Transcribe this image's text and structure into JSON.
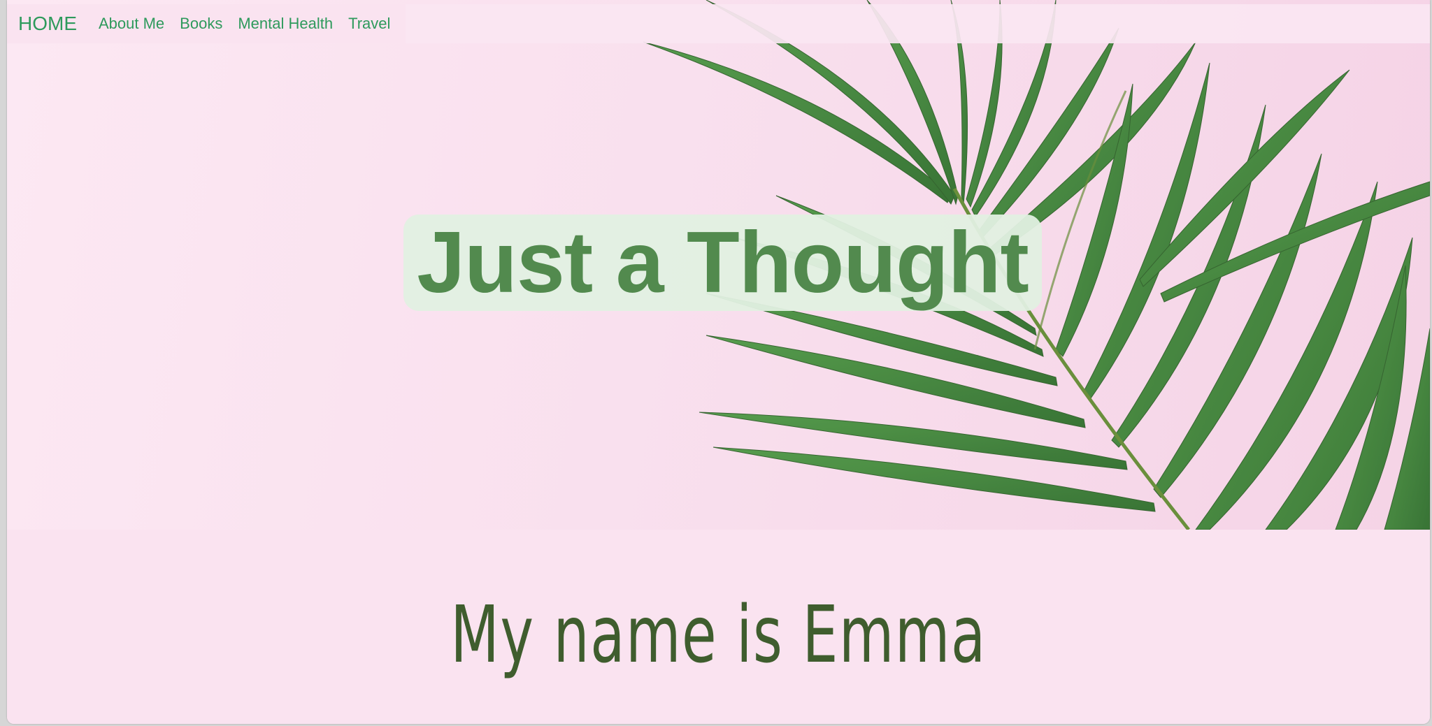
{
  "nav": {
    "brand": "HOME",
    "links": [
      {
        "label": "About Me"
      },
      {
        "label": "Books"
      },
      {
        "label": "Mental Health"
      },
      {
        "label": "Travel"
      }
    ]
  },
  "hero": {
    "title": "Just a Thought",
    "background_image": "palm-leaf-icon"
  },
  "intro": {
    "heading": "My name is Emma"
  },
  "colors": {
    "background": "#fae3f0",
    "nav_text": "#2e9a5c",
    "title_text": "#528a4e",
    "title_bg": "#e2f0e1",
    "heading_text": "#3f5d2e"
  }
}
